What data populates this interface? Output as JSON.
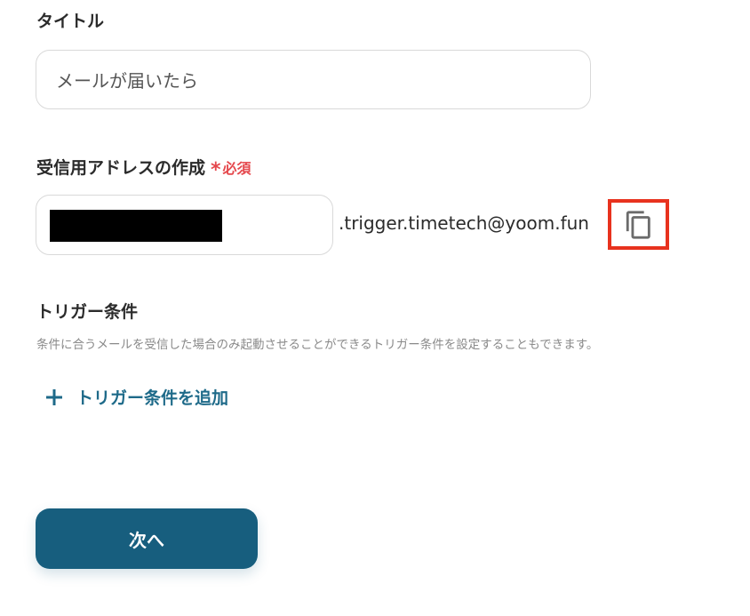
{
  "title_field": {
    "label": "タイトル",
    "value": "メールが届いたら"
  },
  "address_field": {
    "label": "受信用アドレスの作成",
    "required_mark": "*",
    "required_text": "必須",
    "prefix_value": "",
    "domain_suffix": ".trigger.timetech@yoom.fun",
    "copy_icon": "copy-icon"
  },
  "trigger_conditions": {
    "label": "トリガー条件",
    "description": "条件に合うメールを受信した場合のみ起動させることができるトリガー条件を設定することもできます。",
    "add_label": "トリガー条件を追加",
    "add_icon": "plus-icon"
  },
  "next_button": {
    "label": "次へ"
  },
  "colors": {
    "accent": "#175e7e",
    "link": "#1e6a89",
    "required": "#e5484d",
    "highlight_box": "#e8321e"
  }
}
